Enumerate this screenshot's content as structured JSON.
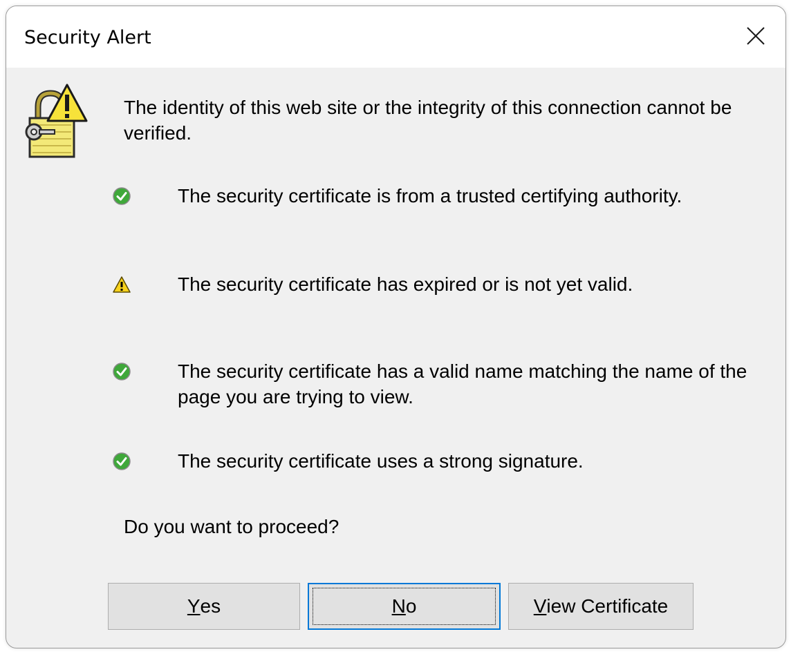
{
  "window": {
    "title": "Security Alert"
  },
  "message": "The identity of this web site or the integrity of this connection cannot be verified.",
  "items": [
    {
      "icon": "check-icon",
      "text": "The security certificate is from a trusted certifying authority."
    },
    {
      "icon": "warning-icon",
      "text": "The security certificate has expired or is not yet valid."
    },
    {
      "icon": "check-icon",
      "text": "The security certificate has a valid name matching the name of the page you are trying to view."
    },
    {
      "icon": "check-icon",
      "text": "The security certificate uses a strong signature."
    }
  ],
  "question": "Do you want to proceed?",
  "buttons": {
    "yes": {
      "accel": "Y",
      "rest": "es"
    },
    "no": {
      "accel": "N",
      "rest": "o"
    },
    "view_certificate": {
      "accel": "V",
      "rest": "iew Certificate"
    }
  },
  "colors": {
    "dialog_bg": "#f0f0f0",
    "titlebar_bg": "#ffffff",
    "check_green": "#3fa83a",
    "warning_yellow": "#f7d21c",
    "focus_blue": "#0078d7"
  }
}
